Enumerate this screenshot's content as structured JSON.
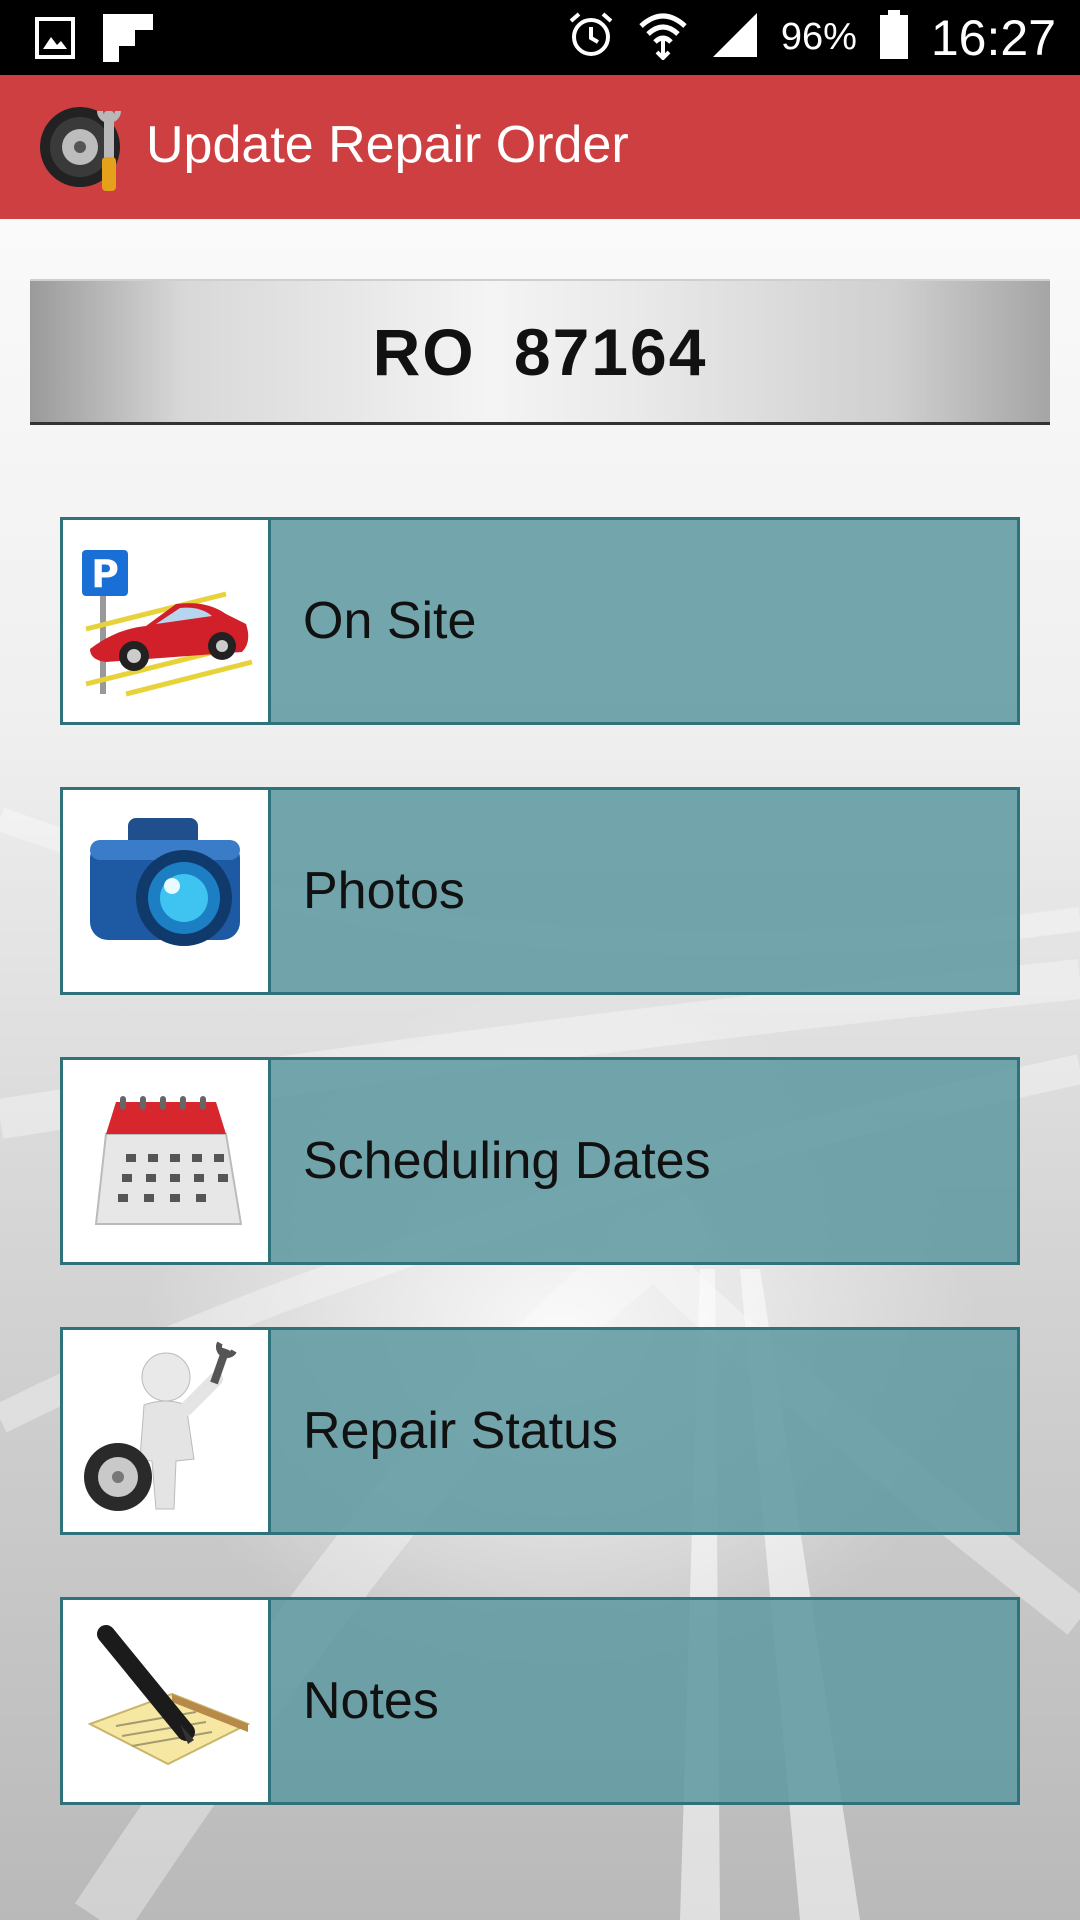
{
  "status_bar": {
    "battery": "96%",
    "time": "16:27",
    "icons": [
      "gallery-icon",
      "flipboard-icon",
      "alarm-icon",
      "wifi-icon",
      "signal-icon",
      "battery-icon"
    ]
  },
  "app_bar": {
    "title": "Update Repair Order",
    "logo_icon": "tire-wrench-logo-icon",
    "color": "#cd3f40"
  },
  "repair_order": {
    "label": "RO  87164"
  },
  "menu": {
    "accent": "#609aa2",
    "items": [
      {
        "label": "On Site",
        "icon": "parked-car-icon"
      },
      {
        "label": "Photos",
        "icon": "camera-icon"
      },
      {
        "label": "Scheduling Dates",
        "icon": "calendar-icon"
      },
      {
        "label": "Repair Status",
        "icon": "mechanic-figure-icon"
      },
      {
        "label": "Notes",
        "icon": "notepad-pen-icon"
      }
    ]
  }
}
